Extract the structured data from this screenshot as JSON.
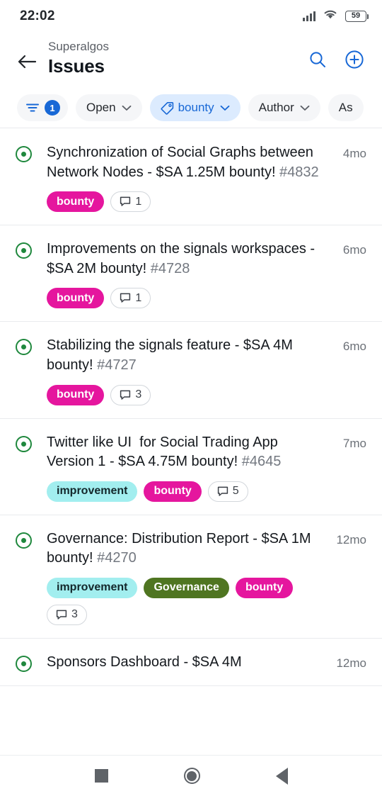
{
  "status_bar": {
    "time": "22:02",
    "battery_level": "59",
    "signal_icon": "cellular-signal-icon",
    "wifi_icon": "wifi-icon",
    "battery_icon": "battery-icon"
  },
  "header": {
    "back_icon": "back-arrow-icon",
    "repo": "Superalgos",
    "title": "Issues",
    "search_icon": "search-icon",
    "create_icon": "plus-circle-icon"
  },
  "filters": {
    "filter_icon": "filter-icon",
    "active_count": "1",
    "chips": [
      {
        "label": "Open",
        "active": false,
        "has_chevron": true,
        "icon": null
      },
      {
        "label": "bounty",
        "active": true,
        "has_chevron": true,
        "icon": "tag-icon"
      },
      {
        "label": "Author",
        "active": false,
        "has_chevron": true,
        "icon": null
      },
      {
        "label": "As",
        "active": false,
        "has_chevron": false,
        "icon": null
      }
    ]
  },
  "colors": {
    "accent_blue": "#1868d6",
    "open_green": "#1f883d",
    "label_bounty_bg": "#e5169e",
    "label_bounty_fg": "#ffffff",
    "label_improvement_bg": "#a2eeef",
    "label_improvement_fg": "#13272b",
    "label_governance_bg": "#4f7521",
    "label_governance_fg": "#ffffff",
    "chip_active_bg": "#dcebfe"
  },
  "issues": [
    {
      "state_icon": "issue-open-icon",
      "title": "Synchronization of Social Graphs between Network Nodes - $SA 1.25M bounty!",
      "number": "#4832",
      "timestamp": "4mo",
      "labels": [
        {
          "text": "bounty",
          "bg": "#e5169e",
          "fg": "#ffffff"
        }
      ],
      "comments": "1"
    },
    {
      "state_icon": "issue-open-icon",
      "title": "Improvements on the signals workspaces - $SA 2M bounty!",
      "number": "#4728",
      "timestamp": "6mo",
      "labels": [
        {
          "text": "bounty",
          "bg": "#e5169e",
          "fg": "#ffffff"
        }
      ],
      "comments": "1"
    },
    {
      "state_icon": "issue-open-icon",
      "title": "Stabilizing the signals feature - $SA 4M bounty!",
      "number": "#4727",
      "timestamp": "6mo",
      "labels": [
        {
          "text": "bounty",
          "bg": "#e5169e",
          "fg": "#ffffff"
        }
      ],
      "comments": "3"
    },
    {
      "state_icon": "issue-open-icon",
      "title": "Twitter like UI  for Social Trading App Version 1 - $SA 4.75M bounty!",
      "number": "#4645",
      "timestamp": "7mo",
      "labels": [
        {
          "text": "improvement",
          "bg": "#a2eeef",
          "fg": "#13272b"
        },
        {
          "text": "bounty",
          "bg": "#e5169e",
          "fg": "#ffffff"
        }
      ],
      "comments": "5"
    },
    {
      "state_icon": "issue-open-icon",
      "title": "Governance: Distribution Report - $SA 1M bounty!",
      "number": "#4270",
      "timestamp": "12mo",
      "labels": [
        {
          "text": "improvement",
          "bg": "#a2eeef",
          "fg": "#13272b"
        },
        {
          "text": "Governance",
          "bg": "#4f7521",
          "fg": "#ffffff"
        },
        {
          "text": "bounty",
          "bg": "#e5169e",
          "fg": "#ffffff"
        }
      ],
      "comments": "3"
    },
    {
      "state_icon": "issue-open-icon",
      "title": "Sponsors Dashboard - $SA 4M",
      "number": "",
      "timestamp": "12mo",
      "labels": [],
      "comments": ""
    }
  ],
  "nav_bar": {
    "recents_icon": "square-recents-icon",
    "home_icon": "circle-home-icon",
    "back_icon": "triangle-back-icon"
  }
}
